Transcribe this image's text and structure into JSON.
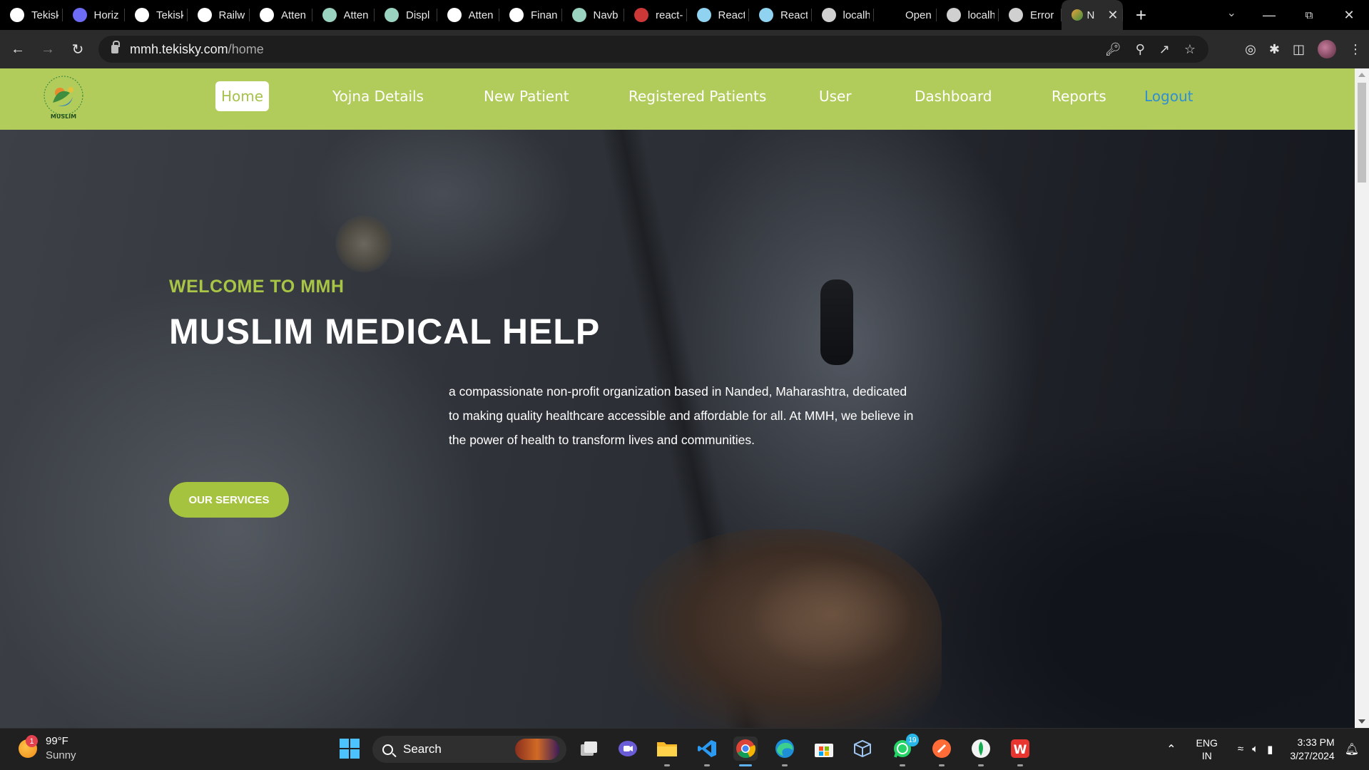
{
  "browser": {
    "tabs": [
      {
        "label": "Tekisk",
        "icon": "github-icon",
        "color": "#ffffff"
      },
      {
        "label": "Horiz",
        "icon": "horizon-icon",
        "color": "#6c6cf5"
      },
      {
        "label": "Tekisk",
        "icon": "tekisky-icon",
        "color": "#ffffff"
      },
      {
        "label": "Railw",
        "icon": "railway-icon",
        "color": "#ffffff"
      },
      {
        "label": "Atten",
        "icon": "github-icon",
        "color": "#ffffff"
      },
      {
        "label": "Atten",
        "icon": "chatgpt-icon",
        "color": "#9ad3c0"
      },
      {
        "label": "Displ",
        "icon": "chatgpt-icon",
        "color": "#9ad3c0"
      },
      {
        "label": "Atten",
        "icon": "github-icon",
        "color": "#ffffff"
      },
      {
        "label": "Finan",
        "icon": "codepen-icon",
        "color": "#ffffff"
      },
      {
        "label": "Navb",
        "icon": "chatgpt-icon",
        "color": "#9ad3c0"
      },
      {
        "label": "react-",
        "icon": "npm-icon",
        "color": "#cb3837"
      },
      {
        "label": "React",
        "icon": "react-icon",
        "color": "#8fd3f0"
      },
      {
        "label": "React",
        "icon": "react-icon",
        "color": "#8fd3f0"
      },
      {
        "label": "localh",
        "icon": "globe-icon",
        "color": "#d0d0d0"
      },
      {
        "label": "Open",
        "icon": "blank-icon",
        "color": "#000000"
      },
      {
        "label": "localh",
        "icon": "globe-icon",
        "color": "#d0d0d0"
      },
      {
        "label": "Error",
        "icon": "globe-icon",
        "color": "#d0d0d0"
      }
    ],
    "active_tab": {
      "label": "N",
      "close": "✕"
    },
    "new_tab": "+",
    "url_host": "mmh.tekisky.com",
    "url_path": "/home"
  },
  "site": {
    "logo_text": "MUSLIM",
    "nav": [
      {
        "label": "Home",
        "name": "nav-home"
      },
      {
        "label": "Yojna Details",
        "name": "nav-yojna-details"
      },
      {
        "label": "New Patient",
        "name": "nav-new-patient"
      },
      {
        "label": "Registered Patients",
        "name": "nav-registered-patients"
      },
      {
        "label": "User",
        "name": "nav-user"
      },
      {
        "label": "Dashboard",
        "name": "nav-dashboard"
      },
      {
        "label": "Reports",
        "name": "nav-reports"
      },
      {
        "label": "Logout",
        "name": "nav-logout"
      }
    ],
    "hero": {
      "welcome": "WELCOME TO MMH",
      "title": "MUSLIM MEDICAL HELP",
      "description": "a compassionate non-profit organization based in Nanded, Maharashtra, dedicated to making quality healthcare accessible and affordable for all. At MMH, we believe in the power of health to transform lives and communities.",
      "button": "OUR SERVICES"
    },
    "colors": {
      "nav_bg": "#b2cc5b",
      "accent": "#a6c33f",
      "logout": "#2f8fd1"
    }
  },
  "taskbar": {
    "weather": {
      "temp": "99°F",
      "condition": "Sunny",
      "badge": "1"
    },
    "search_label": "Search",
    "whatsapp_badge": "19",
    "lang_top": "ENG",
    "lang_bottom": "IN",
    "time": "3:33 PM",
    "date": "3/27/2024"
  }
}
